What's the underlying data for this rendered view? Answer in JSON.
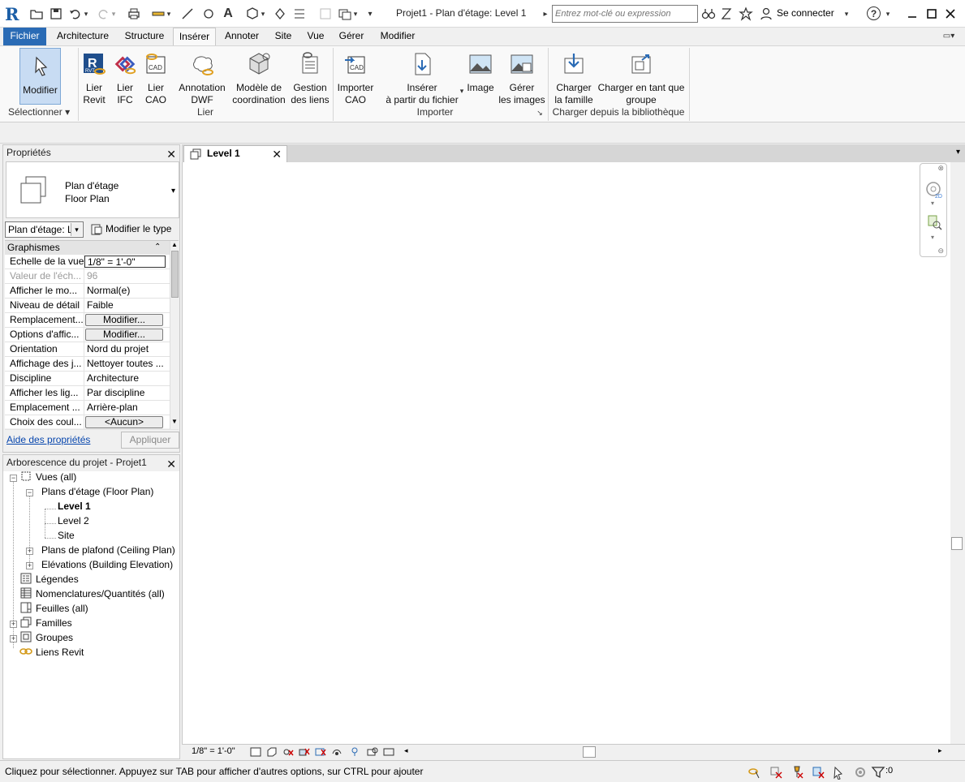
{
  "titlebar": {
    "app_logo": "R",
    "window_title": "Projet1 - Plan d'étage: Level 1",
    "search_placeholder": "Entrez mot-clé ou expression",
    "sign_in": "Se connecter",
    "help": "?"
  },
  "menu": {
    "tabs": [
      {
        "label": "Fichier"
      },
      {
        "label": "Architecture"
      },
      {
        "label": "Structure"
      },
      {
        "label": "Insérer"
      },
      {
        "label": "Annoter"
      },
      {
        "label": "Site"
      },
      {
        "label": "Vue"
      },
      {
        "label": "Gérer"
      },
      {
        "label": "Modifier"
      }
    ],
    "active": "Insérer"
  },
  "ribbon": {
    "buttons": [
      {
        "line1": "Modifier",
        "line2": "",
        "icon": "cursor-icon"
      },
      {
        "line1": "Lier",
        "line2": "Revit",
        "icon": "link-revit-icon"
      },
      {
        "line1": "Lier",
        "line2": "IFC",
        "icon": "link-ifc-icon"
      },
      {
        "line1": "Lier",
        "line2": "CAO",
        "icon": "link-cad-icon"
      },
      {
        "line1": "Annotation",
        "line2": "DWF",
        "icon": "dwf-markup-icon"
      },
      {
        "line1": "Modèle de",
        "line2": "coordination",
        "icon": "coordination-model-icon"
      },
      {
        "line1": "Gestion",
        "line2": "des liens",
        "icon": "manage-links-icon"
      },
      {
        "line1": "Importer",
        "line2": "CAO",
        "icon": "import-cad-icon"
      },
      {
        "line1": "Insérer",
        "line2": "à partir du fichier",
        "icon": "insert-file-icon"
      },
      {
        "line1": "Image",
        "line2": "",
        "icon": "image-icon"
      },
      {
        "line1": "Gérer",
        "line2": "les images",
        "icon": "manage-images-icon"
      },
      {
        "line1": "Charger",
        "line2": "la famille",
        "icon": "load-family-icon"
      },
      {
        "line1": "Charger en tant que",
        "line2": "groupe",
        "icon": "load-group-icon"
      }
    ],
    "groups": [
      "Sélectionner",
      "Lier",
      "Importer",
      "Charger depuis la bibliothèque"
    ]
  },
  "properties": {
    "title": "Propriétés",
    "type_line1": "Plan d'étage",
    "type_line2": "Floor Plan",
    "instance_select": "Plan d'étage: L",
    "edit_type": "Modifier le type",
    "category": "Graphismes",
    "rows": [
      {
        "name": "Echelle de la vue",
        "value": "1/8\" = 1'-0\""
      },
      {
        "name": "Valeur de l'éch...",
        "value": "96"
      },
      {
        "name": "Afficher le mo...",
        "value": "Normal(e)"
      },
      {
        "name": "Niveau de détail",
        "value": "Faible"
      },
      {
        "name": "Remplacement...",
        "value": "Modifier..."
      },
      {
        "name": "Options d'affic...",
        "value": "Modifier..."
      },
      {
        "name": "Orientation",
        "value": "Nord du projet"
      },
      {
        "name": "Affichage des j...",
        "value": "Nettoyer toutes ..."
      },
      {
        "name": "Discipline",
        "value": "Architecture"
      },
      {
        "name": "Afficher les lig...",
        "value": "Par discipline"
      },
      {
        "name": "Emplacement ...",
        "value": "Arrière-plan"
      },
      {
        "name": "Choix des coul...",
        "value": "<Aucun>"
      }
    ],
    "help_link": "Aide des propriétés",
    "apply": "Appliquer"
  },
  "browser": {
    "title": "Arborescence du projet - Projet1",
    "nodes": [
      "Vues (all)",
      "Plans d'étage (Floor Plan)",
      "Level 1",
      "Level 2",
      "Site",
      "Plans de plafond (Ceiling Plan)",
      "Elévations (Building Elevation)",
      "Légendes",
      "Nomenclatures/Quantités (all)",
      "Feuilles (all)",
      "Familles",
      "Groupes",
      "Liens Revit"
    ]
  },
  "view": {
    "tab": "Level 1",
    "scale": "1/8\" = 1'-0\""
  },
  "status": {
    "text": "Cliquez pour sélectionner. Appuyez sur TAB pour afficher d'autres options, sur CTRL pour ajouter d",
    "filter_count": ":0"
  }
}
